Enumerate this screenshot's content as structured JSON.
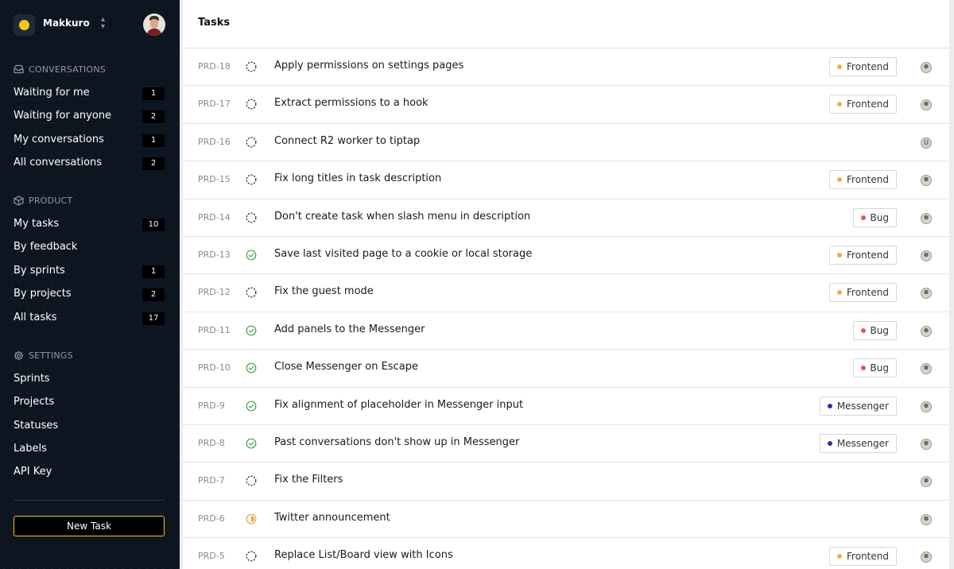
{
  "workspace": {
    "name": "Makkuro"
  },
  "sidebar": {
    "conversations": {
      "title": "Conversations",
      "items": [
        {
          "label": "Waiting for me",
          "count": "1"
        },
        {
          "label": "Waiting for anyone",
          "count": "2"
        },
        {
          "label": "My conversations",
          "count": "1"
        },
        {
          "label": "All conversations",
          "count": "2"
        }
      ]
    },
    "product": {
      "title": "Product",
      "items": [
        {
          "label": "My tasks",
          "count": "10"
        },
        {
          "label": "By feedback",
          "count": ""
        },
        {
          "label": "By sprints",
          "count": "1"
        },
        {
          "label": "By projects",
          "count": "2"
        },
        {
          "label": "All tasks",
          "count": "17"
        }
      ]
    },
    "settings": {
      "title": "Settings",
      "items": [
        {
          "label": "Sprints"
        },
        {
          "label": "Projects"
        },
        {
          "label": "Statuses"
        },
        {
          "label": "Labels"
        },
        {
          "label": "API Key"
        }
      ]
    },
    "new_task_label": "New Task"
  },
  "main": {
    "title": "Tasks",
    "tasks": [
      {
        "id": "PRD-18",
        "status": "todo",
        "title": "Apply permissions on settings pages",
        "tag": "Frontend",
        "tag_color": "#e8b04a",
        "assignee": "avatar"
      },
      {
        "id": "PRD-17",
        "status": "todo",
        "title": "Extract permissions to a hook",
        "tag": "Frontend",
        "tag_color": "#e8b04a",
        "assignee": "avatar"
      },
      {
        "id": "PRD-16",
        "status": "todo",
        "title": "Connect R2 worker to tiptap",
        "tag": "",
        "tag_color": "",
        "assignee": "U"
      },
      {
        "id": "PRD-15",
        "status": "todo",
        "title": "Fix long titles in task description",
        "tag": "Frontend",
        "tag_color": "#e8b04a",
        "assignee": "avatar"
      },
      {
        "id": "PRD-14",
        "status": "todo",
        "title": "Don't create task when slash menu in description",
        "tag": "Bug",
        "tag_color": "#e05a4f",
        "assignee": "avatar"
      },
      {
        "id": "PRD-13",
        "status": "done",
        "title": "Save last visited page to a cookie or local storage",
        "tag": "Frontend",
        "tag_color": "#e8b04a",
        "assignee": "avatar"
      },
      {
        "id": "PRD-12",
        "status": "todo",
        "title": "Fix the guest mode",
        "tag": "Frontend",
        "tag_color": "#e8b04a",
        "assignee": "avatar"
      },
      {
        "id": "PRD-11",
        "status": "done",
        "title": "Add panels to the Messenger",
        "tag": "Bug",
        "tag_color": "#e05a4f",
        "assignee": "avatar"
      },
      {
        "id": "PRD-10",
        "status": "done",
        "title": "Close Messenger on Escape",
        "tag": "Bug",
        "tag_color": "#e05a4f",
        "assignee": "avatar"
      },
      {
        "id": "PRD-9",
        "status": "done",
        "title": "Fix alignment of placeholder in Messenger input",
        "tag": "Messenger",
        "tag_color": "#4b1fa8",
        "assignee": "avatar"
      },
      {
        "id": "PRD-8",
        "status": "done",
        "title": "Past conversations don't show up in Messenger",
        "tag": "Messenger",
        "tag_color": "#4b1fa8",
        "assignee": "avatar"
      },
      {
        "id": "PRD-7",
        "status": "todo",
        "title": "Fix the Filters",
        "tag": "",
        "tag_color": "",
        "assignee": "avatar"
      },
      {
        "id": "PRD-6",
        "status": "in-progress",
        "title": "Twitter announcement",
        "tag": "",
        "tag_color": "",
        "assignee": "avatar"
      },
      {
        "id": "PRD-5",
        "status": "todo",
        "title": "Replace List/Board view with Icons",
        "tag": "Frontend",
        "tag_color": "#e8b04a",
        "assignee": "avatar"
      }
    ]
  },
  "colors": {
    "accent": "#f5c518",
    "done": "#3fa34d",
    "in_progress": "#e8a33a",
    "sidebar_bg": "#0d1620"
  }
}
